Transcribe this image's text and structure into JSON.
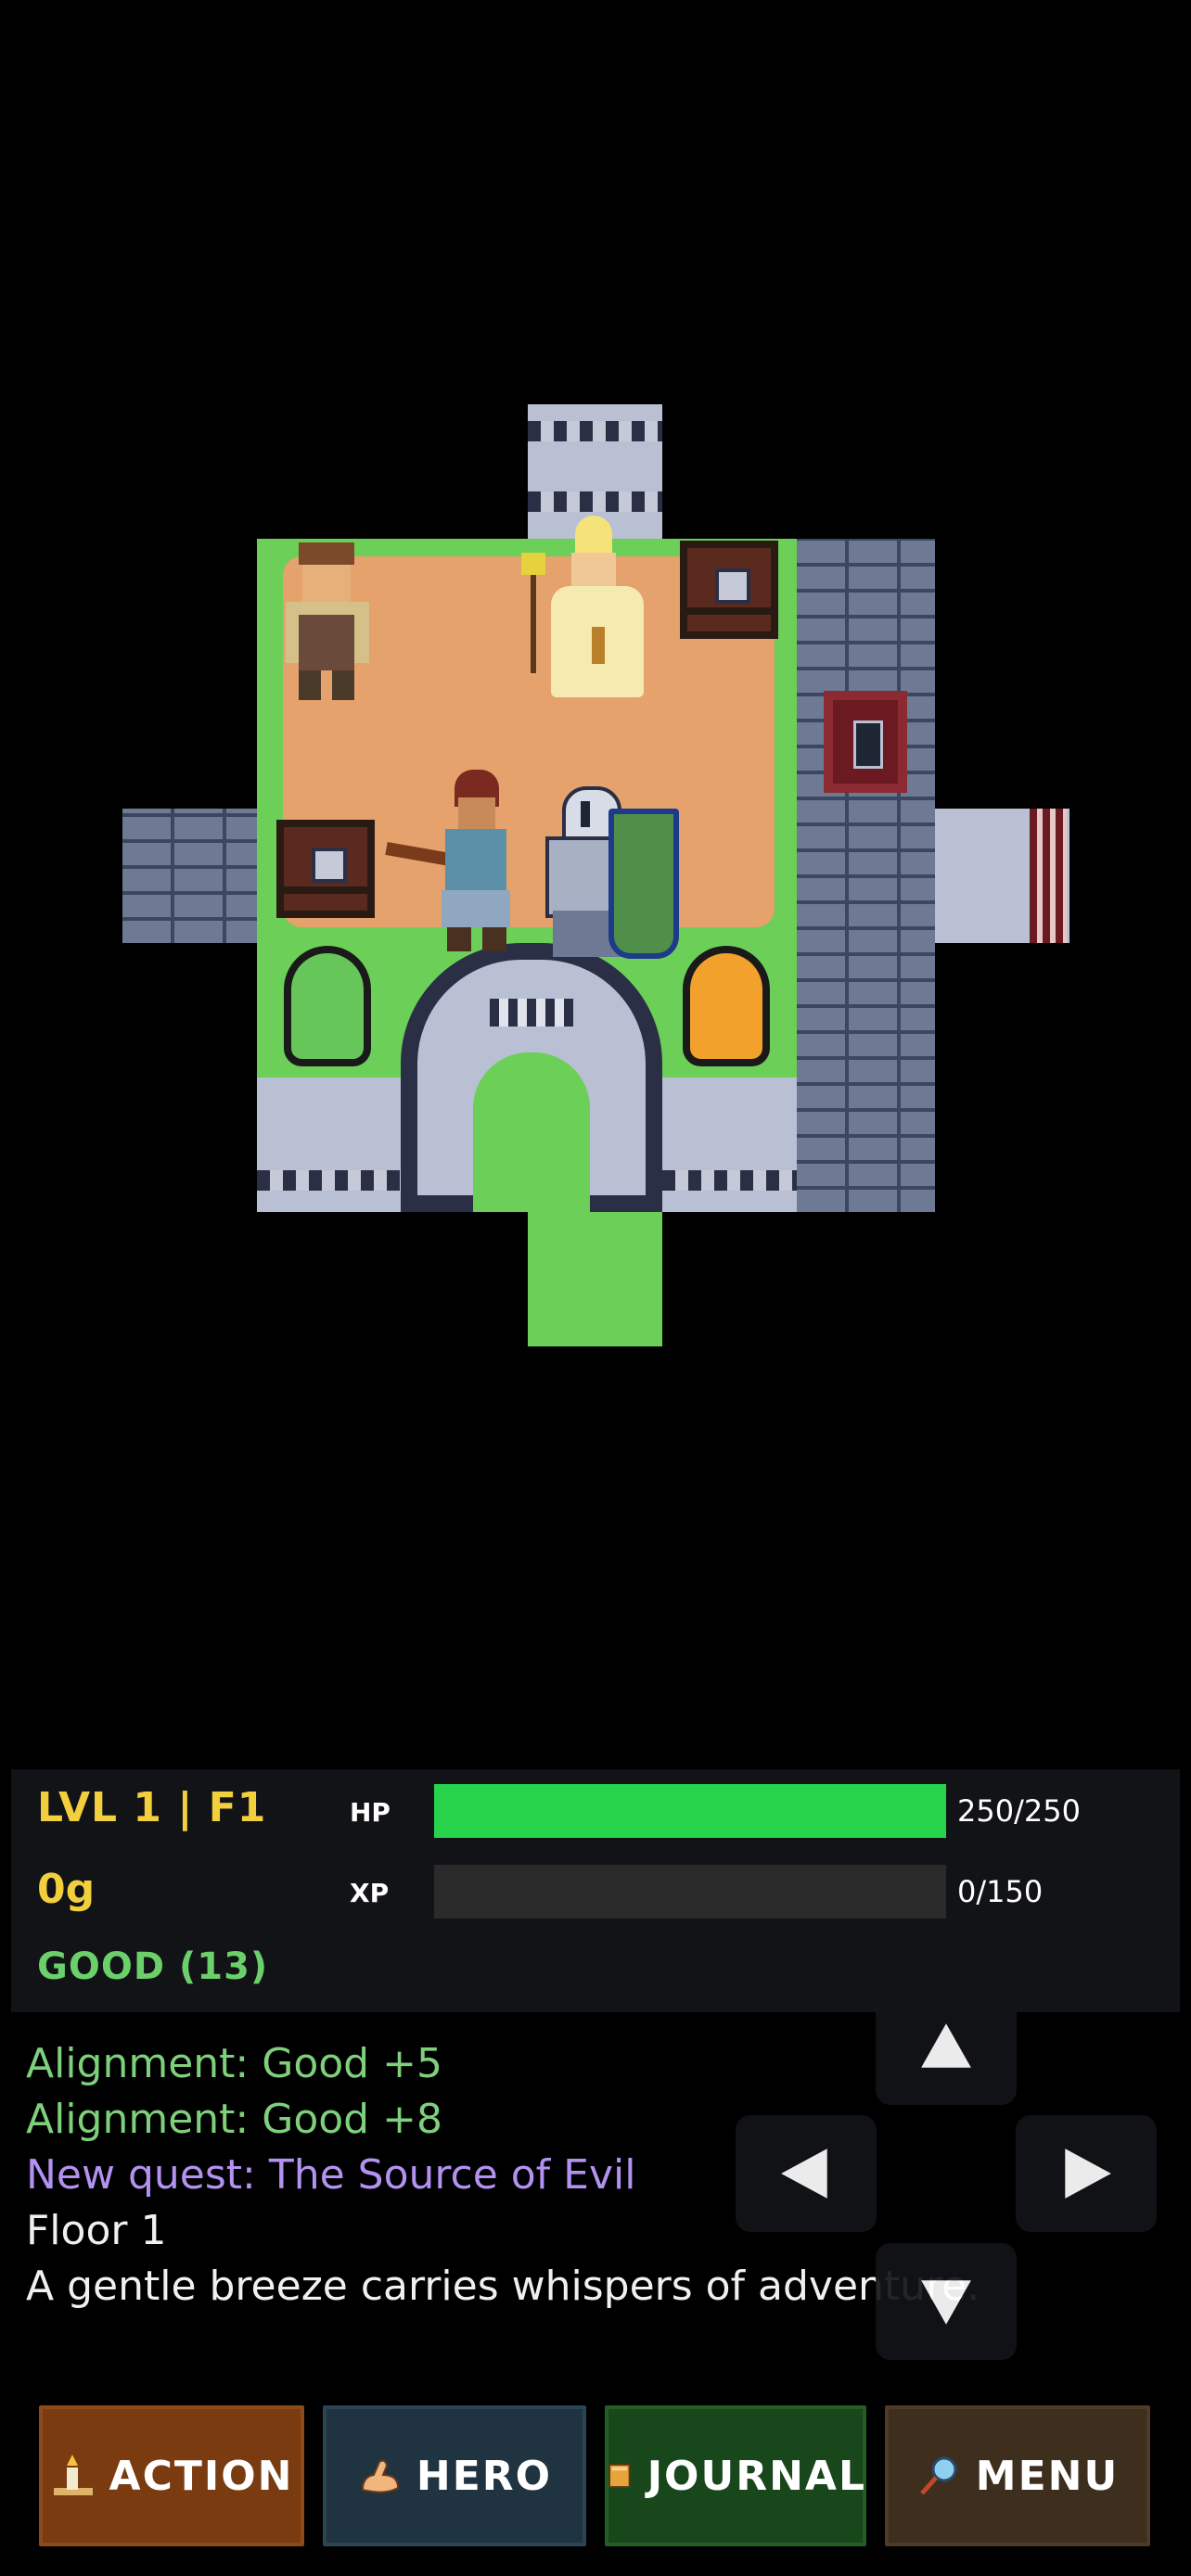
{
  "hud": {
    "level": "LVL 1 | F1",
    "gold": "0g",
    "alignment_status": "GOOD (13)",
    "hp_label": "HP",
    "hp_value": "250/250",
    "hp_fraction": 1.0,
    "xp_label": "XP",
    "xp_value": "0/150",
    "xp_fraction": 0.0
  },
  "log": [
    {
      "text": "Alignment: Good +5",
      "color": "green"
    },
    {
      "text": "Alignment: Good +8",
      "color": "green"
    },
    {
      "text": "New quest: The Source of Evil",
      "color": "purple"
    },
    {
      "text": "Floor 1",
      "color": "white"
    },
    {
      "text": "A gentle breeze carries whispers of adventure.",
      "color": "white"
    }
  ],
  "dpad": {
    "up": "arrow-up-icon",
    "left": "arrow-left-icon",
    "right": "arrow-right-icon",
    "down": "arrow-down-icon"
  },
  "buttons": {
    "action": {
      "label": "ACTION",
      "icon": "candle-icon"
    },
    "hero": {
      "label": "HERO",
      "icon": "flexed-arm-icon"
    },
    "journal": {
      "label": "JOURNAL",
      "icon": "book-icon"
    },
    "menu": {
      "label": "MENU",
      "icon": "magnifier-icon"
    }
  },
  "colors": {
    "hp": "#27d34a",
    "xp": "#ececec",
    "gold_text": "#f2cf3c",
    "good_text": "#6bd06a",
    "quest_text": "#b392f0"
  }
}
